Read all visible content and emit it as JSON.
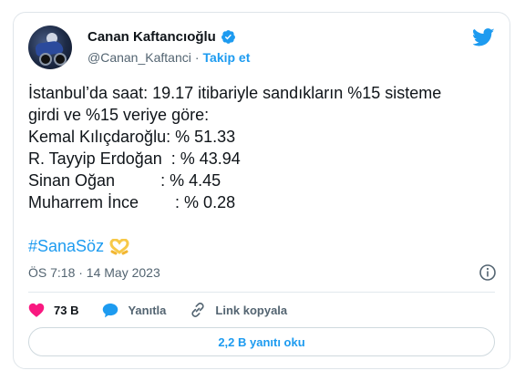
{
  "tweet": {
    "author_name": "Canan Kaftancıoğlu",
    "handle": "@Canan_Kaftanci",
    "separator": "·",
    "follow_label": "Takip et",
    "text": "İstanbul’da saat: 19.17 itibariyle sandıkların %15 sisteme\ngirdi ve %15 veriye göre:\nKemal Kılıçdaroğlu: % 51.33\nR. Tayyip Erdoğan  : % 43.94\nSinan Oğan          : % 4.45\nMuharrem İnce        : % 0.28",
    "hashtag": "#SanaSöz",
    "timestamp": "ÖS 7:18 · 14 May 2023"
  },
  "actions": {
    "like_count": "73 B",
    "reply_label": "Yanıtla",
    "copy_link_label": "Link kopyala"
  },
  "replies_button_label": "2,2 B yanıtı oku",
  "colors": {
    "accent": "#1d9bf0",
    "like": "#f91880",
    "text": "#0f1419",
    "muted": "#536471"
  },
  "icons": [
    "verified-badge-icon",
    "twitter-bird-icon",
    "heart-hands-emoji",
    "info-icon",
    "heart-icon",
    "reply-bubble-icon",
    "link-icon"
  ]
}
